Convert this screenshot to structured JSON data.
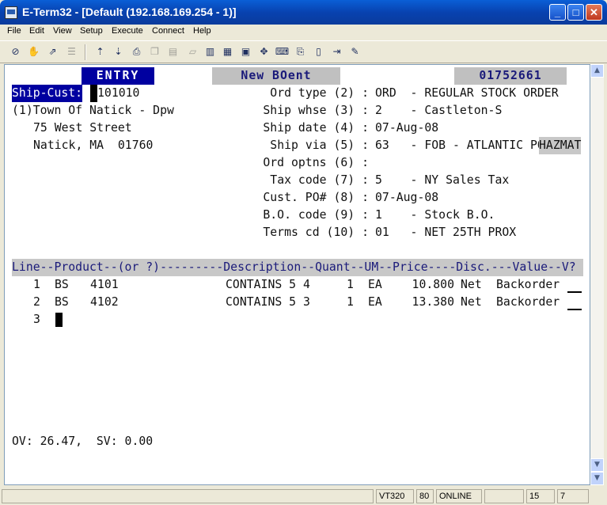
{
  "window": {
    "title": "E-Term32 - [Default (192.168.169.254 - 1)]",
    "minimize_glyph": "_",
    "maximize_glyph": "□",
    "close_glyph": "✕"
  },
  "menu": [
    "File",
    "Edit",
    "View",
    "Setup",
    "Execute",
    "Connect",
    "Help"
  ],
  "toolbar": {
    "icons": [
      "disconnect-icon",
      "hand-icon",
      "connect-icon",
      "print-setup-icon",
      "send-file-icon",
      "receive-file-icon",
      "print-icon",
      "copy-icon",
      "paste-icon",
      "erase-icon",
      "page-icon",
      "split-icon",
      "vt320-icon",
      "keypad-icon",
      "keyboard-icon",
      "capture-icon",
      "script-icon",
      "exit-icon",
      "pen-icon"
    ]
  },
  "terminal": {
    "mode": "ENTRY",
    "screen_title": "New BOent",
    "order_number": "01752661",
    "ship_cust_label": "Ship-Cust:",
    "ship_cust_value": "101010",
    "address": {
      "line1": "(1)Town Of Natick - Dpw",
      "line2": "75 West Street",
      "line3": "Natick, MA  01760"
    },
    "fields": [
      {
        "label": "Ord type (2) :",
        "value": "ORD  - REGULAR STOCK ORDER"
      },
      {
        "label": "Ship whse (3) :",
        "value": "2    - Castleton-S"
      },
      {
        "label": "Ship date (4) :",
        "value": "07-Aug-08"
      },
      {
        "label": "Ship via (5) :",
        "value": "63   - FOB - ATLANTIC PO"
      },
      {
        "label": "Ord optns (6) :",
        "value": ""
      },
      {
        "label": "Tax code (7) :",
        "value": "5    - NY Sales Tax"
      },
      {
        "label": "Cust. PO# (8) :",
        "value": "07-Aug-08"
      },
      {
        "label": "B.O. code (9) :",
        "value": "1    - Stock B.O."
      },
      {
        "label": "Terms cd (10) :",
        "value": "01   - NET 25TH PROX"
      }
    ],
    "hazmat": "HAZMAT",
    "columns_header": "Line--Product--(or ?)---------Description--Quant--UM--Price----Disc.---Value--V?",
    "lines": [
      {
        "line": "1",
        "cat": "BS",
        "product": "4101",
        "description": "CONTAINS 5 4",
        "quant": "1",
        "um": "EA",
        "price": "10.800",
        "disc": "Net",
        "value": "Backorder"
      },
      {
        "line": "2",
        "cat": "BS",
        "product": "4102",
        "description": "CONTAINS 5 3",
        "quant": "1",
        "um": "EA",
        "price": "13.380",
        "disc": "Net",
        "value": "Backorder"
      }
    ],
    "next_line": "3",
    "footer": "OV: 26.47,  SV: 0.00"
  },
  "status": {
    "terminal_type": "VT320",
    "columns": "80",
    "state": "ONLINE",
    "col1": "",
    "row": "15",
    "col": "7"
  }
}
